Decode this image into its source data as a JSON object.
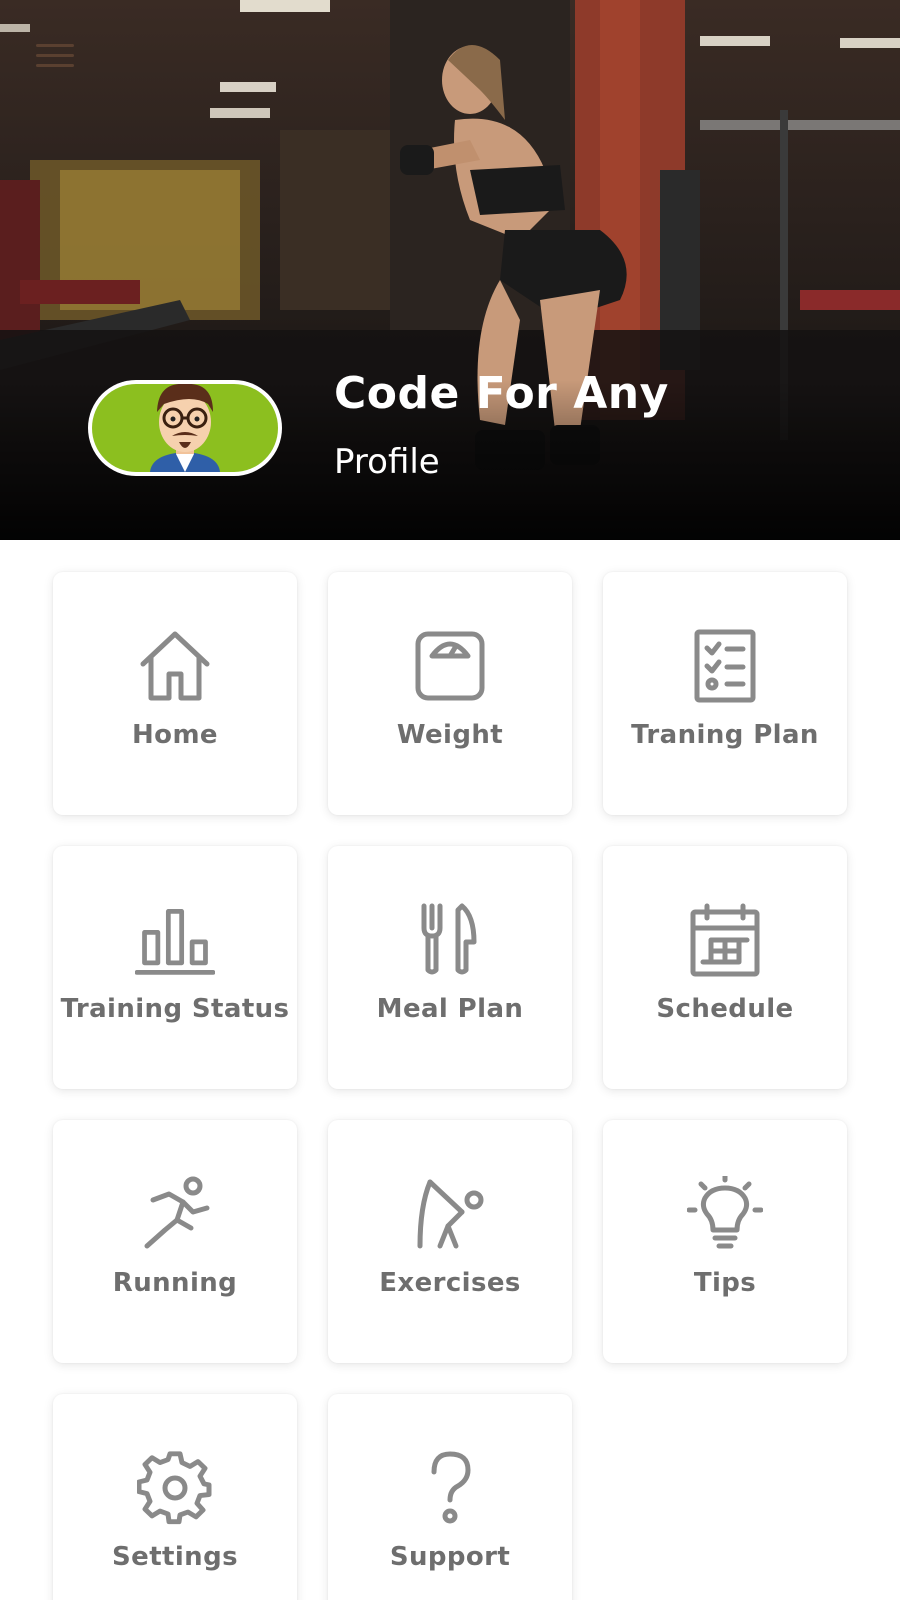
{
  "header": {
    "profile_name": "Code For Any",
    "profile_label": "Profile"
  },
  "menu": {
    "items": [
      {
        "label": "Home",
        "icon": "home-icon"
      },
      {
        "label": "Weight",
        "icon": "scale-icon"
      },
      {
        "label": "Traning Plan",
        "icon": "checklist-icon"
      },
      {
        "label": "Training Status",
        "icon": "bar-chart-icon"
      },
      {
        "label": "Meal Plan",
        "icon": "fork-knife-icon"
      },
      {
        "label": "Schedule",
        "icon": "calendar-icon"
      },
      {
        "label": "Running",
        "icon": "running-icon"
      },
      {
        "label": "Exercises",
        "icon": "stretching-icon"
      },
      {
        "label": "Tips",
        "icon": "lightbulb-icon"
      },
      {
        "label": "Settings",
        "icon": "gear-icon"
      },
      {
        "label": "Support",
        "icon": "question-icon"
      }
    ]
  },
  "colors": {
    "icon": "#8a8a8a",
    "label": "#6e6e6e",
    "avatar_bg": "#8cbf1f",
    "card_bg": "#ffffff"
  }
}
